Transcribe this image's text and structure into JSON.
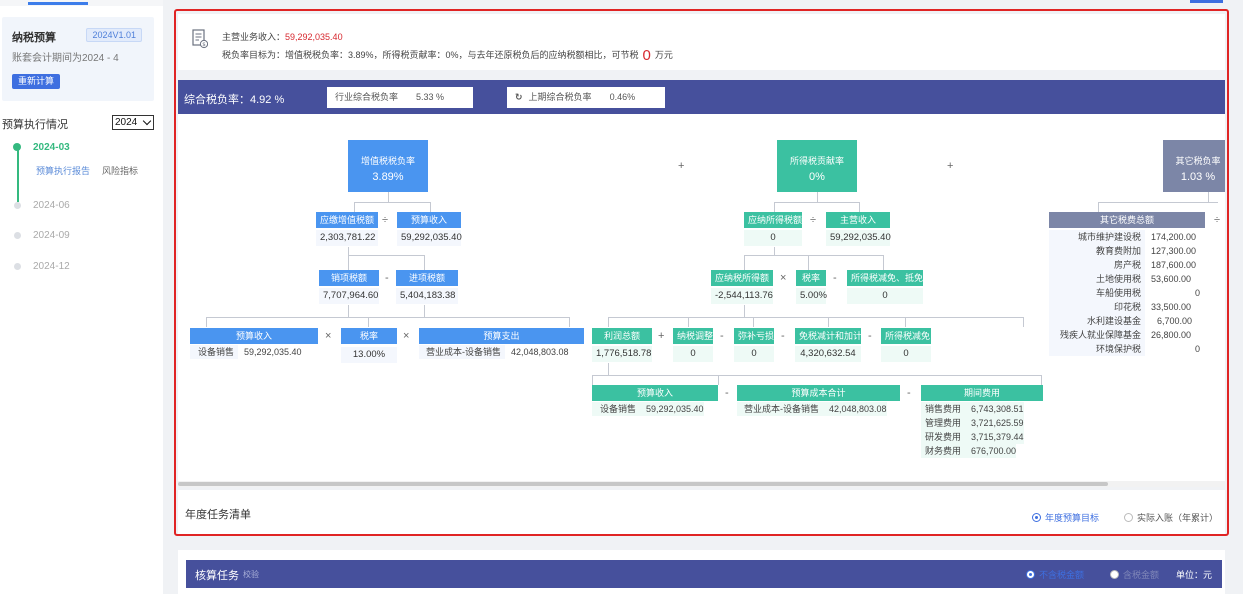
{
  "sidebar": {
    "card_title": "纳税预算",
    "version": "2024V1.01",
    "period": "账套会计期间为2024 - 4",
    "recalc_button": "重新计算",
    "exec_title": "预算执行情况",
    "year": "2024",
    "timeline": [
      {
        "label": "2024-03",
        "active": true
      },
      {
        "label": "2024-06",
        "active": false
      },
      {
        "label": "2024-09",
        "active": false
      },
      {
        "label": "2024-12",
        "active": false
      }
    ],
    "sub_links": [
      "预算执行报告",
      "风险指标"
    ]
  },
  "header": {
    "main_income_label": "主营业务收入：",
    "main_income_value": "59,292,035.40",
    "target_text": "税负率目标为：增值税税负率：3.89%，所得税贡献率：0%，与去年还原税负后的应纳税额相比，可节税",
    "save_value": "0",
    "save_unit": "万元"
  },
  "bar": {
    "overall": "综合税负率：4.92 %",
    "industry_label": "行业综合税负率",
    "industry_value": "5.33 %",
    "last_label": "上期综合税负率",
    "last_value": "0.46%"
  },
  "diagram": {
    "vat": {
      "title": "增值税税负率",
      "value": "3.89%"
    },
    "income_tax": {
      "title": "所得税贡献率",
      "value": "0%"
    },
    "other": {
      "title": "其它税负率",
      "value": "1.03 %"
    },
    "plus": "+",
    "minus": "-",
    "times": "×",
    "divide": "÷",
    "vat_payable": {
      "label": "应缴增值税额",
      "value": "2,303,781.22"
    },
    "budget_income": {
      "label": "预算收入",
      "value": "59,292,035.40"
    },
    "output_tax": {
      "label": "销项税额",
      "value": "7,707,964.60"
    },
    "input_tax": {
      "label": "进项税额",
      "value": "5,404,183.38"
    },
    "income_detail": {
      "label": "预算收入",
      "k": "设备销售",
      "v": "59,292,035.40"
    },
    "tax_rate": {
      "label": "税率",
      "value": "13.00%"
    },
    "budget_expense": {
      "label": "预算支出",
      "k": "营业成本-设备销售",
      "v": "42,048,803.08"
    },
    "income_tax_payable": {
      "label": "应纳所得税额",
      "value": "0"
    },
    "main_income": {
      "label": "主营收入",
      "value": "59,292,035.40"
    },
    "taxable_income": {
      "label": "应纳税所得额",
      "value": "-2,544,113.76"
    },
    "it_rate": {
      "label": "税率",
      "value": "5.00%"
    },
    "it_reduce": {
      "label": "所得税减免、抵免",
      "value": "0"
    },
    "profit": {
      "label": "利润总额",
      "value": "1,776,518.78"
    },
    "tax_adjust": {
      "label": "纳税调整",
      "value": "0"
    },
    "loss_cover": {
      "label": "弥补亏损",
      "value": "0"
    },
    "exempt": {
      "label": "免税减计和加计",
      "value": "4,320,632.54"
    },
    "it_reduce2": {
      "label": "所得税减免",
      "value": "0"
    },
    "p_income": {
      "label": "预算收入",
      "k": "设备销售",
      "v": "59,292,035.40"
    },
    "p_cost": {
      "label": "预算成本合计",
      "k": "营业成本-设备销售",
      "v": "42,048,803.08"
    },
    "period_expense": {
      "label": "期间费用",
      "items": [
        {
          "k": "销售费用",
          "v": "6,743,308.51"
        },
        {
          "k": "管理费用",
          "v": "3,721,625.59"
        },
        {
          "k": "研发费用",
          "v": "3,715,379.44"
        },
        {
          "k": "财务费用",
          "v": "676,700.00"
        }
      ]
    },
    "other_total": {
      "label": "其它税费总额",
      "items": [
        {
          "k": "城市维护建设税",
          "v": "174,200.00"
        },
        {
          "k": "教育费附加",
          "v": "127,300.00"
        },
        {
          "k": "房产税",
          "v": "187,600.00"
        },
        {
          "k": "土地使用税",
          "v": "53,600.00"
        },
        {
          "k": "车船使用税",
          "v": "0"
        },
        {
          "k": "印花税",
          "v": "33,500.00"
        },
        {
          "k": "水利建设基金",
          "v": "6,700.00"
        },
        {
          "k": "残疾人就业保障基金",
          "v": "26,800.00"
        },
        {
          "k": "环境保护税",
          "v": "0"
        }
      ]
    }
  },
  "tasks": {
    "title": "年度任务清单",
    "radio1": "年度预算目标",
    "radio2": "实际入账（年累计）"
  },
  "bottom": {
    "title": "核算任务",
    "sub": "校验",
    "radio1": "不含税金额",
    "radio2": "含税金额",
    "unit": "单位：元"
  }
}
